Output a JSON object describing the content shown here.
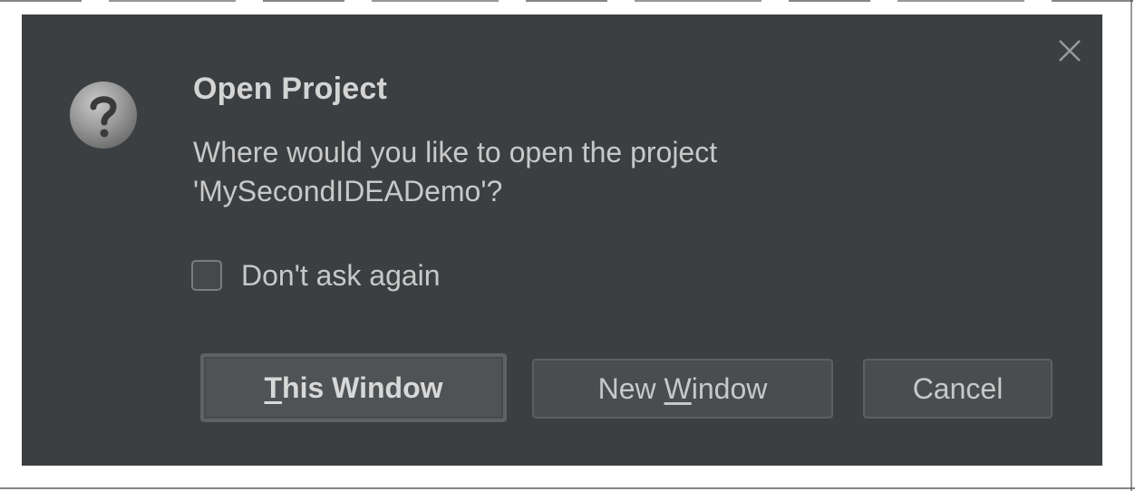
{
  "dialog": {
    "title": "Open Project",
    "message_line1": "Where would you like to open the project",
    "message_line2": "'MySecondIDEADemo'?",
    "checkbox_label": "Don't ask again",
    "checkbox_checked": false,
    "icons": {
      "close": "close-icon",
      "question": "question-icon"
    },
    "colors": {
      "background": "#3c3f41",
      "button": "#4a4d4f",
      "text": "#c8c8c8"
    },
    "buttons": {
      "this_window": {
        "mnemonic": "T",
        "rest": "his Window"
      },
      "new_window": {
        "prefix": "New ",
        "mnemonic": "W",
        "rest": "indow"
      },
      "cancel": "Cancel"
    }
  }
}
